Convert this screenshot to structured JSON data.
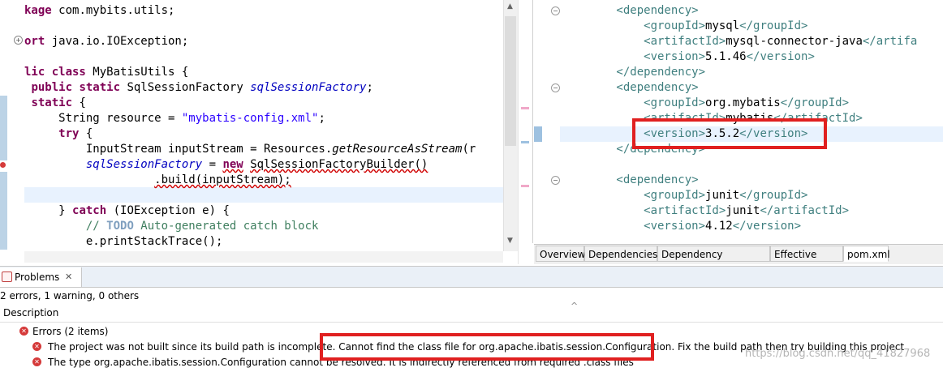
{
  "java_editor": {
    "lines": [
      [
        [
          "kw",
          "kage "
        ],
        [
          "n",
          "com.mybits.utils;"
        ]
      ],
      [],
      [
        [
          "kw",
          "ort "
        ],
        [
          "n",
          "java.io.IOException;"
        ]
      ],
      [],
      [
        [
          "kw",
          "lic class "
        ],
        [
          "n",
          "MyBatisUtils {"
        ]
      ],
      [
        [
          "n",
          " "
        ],
        [
          "kw",
          "public static "
        ],
        [
          "n",
          "SqlSessionFactory "
        ],
        [
          "fld",
          "sqlSessionFactory"
        ],
        [
          "n",
          ";"
        ]
      ],
      [
        [
          "n",
          " "
        ],
        [
          "kw",
          "static "
        ],
        [
          "n",
          "{"
        ]
      ],
      [
        [
          "n",
          "     String resource = "
        ],
        [
          "str",
          "\"mybatis-config.xml\""
        ],
        [
          "n",
          ";"
        ]
      ],
      [
        [
          "n",
          "     "
        ],
        [
          "kw",
          "try "
        ],
        [
          "n",
          "{"
        ]
      ],
      [
        [
          "n",
          "         InputStream inputStream = Resources."
        ],
        [
          "it",
          "getResourceAsStream"
        ],
        [
          "n",
          "(r"
        ]
      ],
      [
        [
          "n",
          "         "
        ],
        [
          "fld",
          "sqlSessionFactory"
        ],
        [
          "n",
          " = "
        ],
        [
          "kwu",
          "new"
        ],
        [
          "n",
          " "
        ],
        [
          "u",
          "SqlSessionFactoryBuilder()"
        ]
      ],
      [
        [
          "n",
          "                   "
        ],
        [
          "u",
          ".build(inputStream);"
        ]
      ],
      [],
      [
        [
          "n",
          "     } "
        ],
        [
          "kw",
          "catch "
        ],
        [
          "n",
          "(IOException e) {"
        ]
      ],
      [
        [
          "n",
          "         "
        ],
        [
          "cm",
          "// "
        ],
        [
          "todo",
          "TODO"
        ],
        [
          "cm",
          " Auto-generated catch block"
        ]
      ],
      [
        [
          "n",
          "         e.printStackTrace();"
        ]
      ]
    ]
  },
  "xml_editor": {
    "lines": [
      [
        [
          "tag",
          "        <dependency>"
        ]
      ],
      [
        [
          "tag",
          "            <groupId>"
        ],
        [
          "txt",
          "mysql"
        ],
        [
          "tag",
          "</groupId>"
        ]
      ],
      [
        [
          "tag",
          "            <artifactId>"
        ],
        [
          "txt",
          "mysql-connector-java"
        ],
        [
          "tag",
          "</artifa"
        ]
      ],
      [
        [
          "tag",
          "            <version>"
        ],
        [
          "txt",
          "5.1.46"
        ],
        [
          "tag",
          "</version>"
        ]
      ],
      [
        [
          "tag",
          "        </dependency>"
        ]
      ],
      [
        [
          "tag",
          "        <dependency>"
        ]
      ],
      [
        [
          "tag",
          "            <groupId>"
        ],
        [
          "txt",
          "org.mybatis"
        ],
        [
          "tag",
          "</groupId>"
        ]
      ],
      [
        [
          "tag",
          "            <artifactId>"
        ],
        [
          "txt",
          "mybatis"
        ],
        [
          "tag",
          "</artifactId>"
        ]
      ],
      [
        [
          "tag",
          "            <version>"
        ],
        [
          "txt",
          "3.5.2"
        ],
        [
          "tag",
          "</version>"
        ]
      ],
      [
        [
          "tag",
          "        </dependency>"
        ]
      ],
      [],
      [
        [
          "tag",
          "        <dependency>"
        ]
      ],
      [
        [
          "tag",
          "            <groupId>"
        ],
        [
          "txt",
          "junit"
        ],
        [
          "tag",
          "</groupId>"
        ]
      ],
      [
        [
          "tag",
          "            <artifactId>"
        ],
        [
          "txt",
          "junit"
        ],
        [
          "tag",
          "</artifactId>"
        ]
      ],
      [
        [
          "tag",
          "            <version>"
        ],
        [
          "txt",
          "4.12"
        ],
        [
          "tag",
          "</version>"
        ]
      ]
    ]
  },
  "pom_tabs": [
    "Overview",
    "Dependencies",
    "Dependency Hierarchy",
    "Effective POM",
    "pom.xml"
  ],
  "problems": {
    "tab_label": "Problems",
    "close_glyph": "✕",
    "summary": "2 errors, 1 warning, 0 others",
    "column_header": "Description",
    "sort_glyph": "^",
    "group_label": "Errors (2 items)",
    "items": [
      "The project was not built since its build path is incomplete. Cannot find the class file for org.apache.ibatis.session.Configuration. Fix the build path then try building this project",
      "The type org.apache.ibatis.session.Configuration cannot be resolved. It is indirectly referenced from required .class files"
    ]
  },
  "watermark": "https://blog.csdn.net/qq_41827968",
  "colors": {
    "keyword": "#7f0055",
    "string": "#2a00ff",
    "field": "#0000c0",
    "xml_tag": "#3f7f7f",
    "highlight_box": "#e02020"
  }
}
